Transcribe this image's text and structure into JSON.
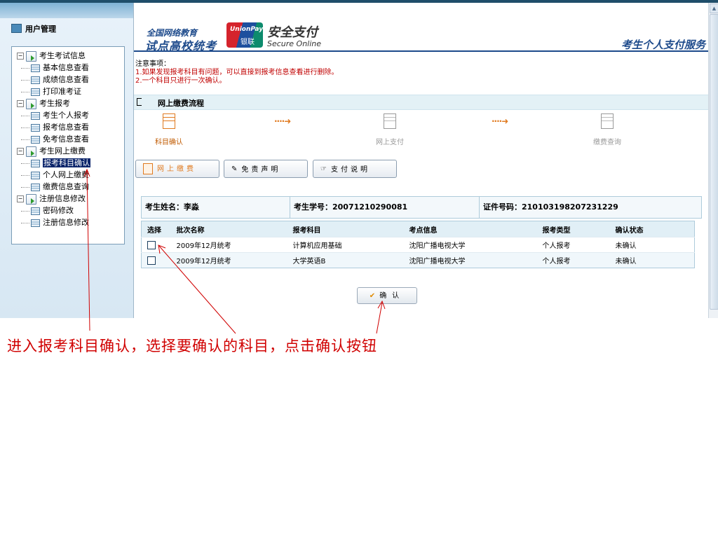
{
  "sidebar": {
    "title": "用户管理",
    "tree": [
      {
        "label": "考生考试信息",
        "children": [
          "基本信息查看",
          "成绩信息查看",
          "打印准考证"
        ]
      },
      {
        "label": "考生报考",
        "children": [
          "考生个人报考",
          "报考信息查看",
          "免考信息查看"
        ]
      },
      {
        "label": "考生网上缴费",
        "children": [
          "报考科目确认",
          "个人网上缴费",
          "缴费信息查询"
        ]
      },
      {
        "label": "注册信息修改",
        "children": [
          "密码修改",
          "注册信息修改"
        ]
      }
    ],
    "selected": "报考科目确认"
  },
  "header": {
    "logo_line1": "全国网络教育",
    "logo_line2": "试点高校统考",
    "unionpay_en": "UnionPay",
    "unionpay_cn": "银联",
    "secure_cn": "安全支付",
    "secure_en": "Secure Online",
    "service_title": "考生个人支付服务"
  },
  "notice": {
    "title": "注意事项：",
    "items": [
      "1.如果发现报考科目有问题，可以直接到报考信息查看进行删除。",
      "2.一个科目只进行一次确认。"
    ]
  },
  "flow": {
    "title": "网上缴费流程",
    "steps": [
      {
        "label": "科目确认",
        "active": true
      },
      {
        "label": "网上支付",
        "active": false
      },
      {
        "label": "缴费查询",
        "active": false
      }
    ],
    "arrow": "····➜"
  },
  "tabs": {
    "pay": "网上缴费",
    "disclaimer": "免责声明",
    "pay_note": "支付说明"
  },
  "student": {
    "name_label": "考生姓名：",
    "name": "李淼",
    "id_label": "考生学号：",
    "id": "20071210290081",
    "cert_label": "证件号码：",
    "cert": "210103198207231229"
  },
  "table": {
    "columns": [
      "选择",
      "批次名称",
      "报考科目",
      "考点信息",
      "报考类型",
      "确认状态"
    ],
    "rows": [
      [
        "",
        "2009年12月统考",
        "计算机应用基础",
        "沈阳广播电视大学",
        "个人报考",
        "未确认"
      ],
      [
        "",
        "2009年12月统考",
        "大学英语B",
        "沈阳广播电视大学",
        "个人报考",
        "未确认"
      ]
    ]
  },
  "confirm_button": "确认",
  "annotation": "进入报考科目确认，选择要确认的科目，点击确认按钮",
  "colors": {
    "accent": "#1d4a8b",
    "annotation": "#d00000",
    "flow_orange": "#e07a1f"
  }
}
